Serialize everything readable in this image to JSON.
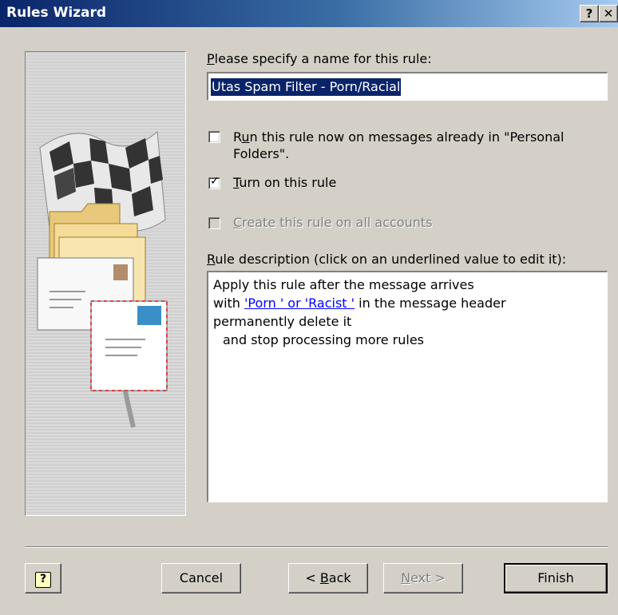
{
  "window": {
    "title": "Rules Wizard",
    "help_caption": "?",
    "close_caption": "✕"
  },
  "name_section": {
    "label_accel": "P",
    "label_rest": "lease specify a name for this rule:",
    "value": "Utas Spam Filter - Porn/Racial"
  },
  "options": {
    "run_now": {
      "line1_pre": "R",
      "line1_accel": "u",
      "line1_post": "n this rule now on messages already in \"Personal",
      "line2": "Folders\".",
      "checked": false
    },
    "turn_on": {
      "accel": "T",
      "rest": "urn on this rule",
      "checked": true
    },
    "all_accounts": {
      "accel": "C",
      "rest": "reate this rule on all accounts",
      "checked": false,
      "enabled": false
    }
  },
  "description": {
    "label_accel": "R",
    "label_rest": "ule description (click on an underlined value to edit it):",
    "line1": "Apply this rule after the message arrives",
    "line2_pre": "with ",
    "line2_link": "'Porn  ' or 'Racist  '",
    "line2_post": " in the message header",
    "line3": "permanently delete it",
    "line4": "and stop processing more rules"
  },
  "buttons": {
    "help_icon": "?",
    "cancel": "Cancel",
    "back_pre": "< ",
    "back_accel": "B",
    "back_rest": "ack",
    "next_accel": "N",
    "next_rest": "ext >",
    "finish": "Finish"
  },
  "colors": {
    "title_gradient_start": "#0a246a",
    "dialog_face": "#d4d0c8",
    "selection": "#0a246a",
    "link": "#0000ff"
  }
}
